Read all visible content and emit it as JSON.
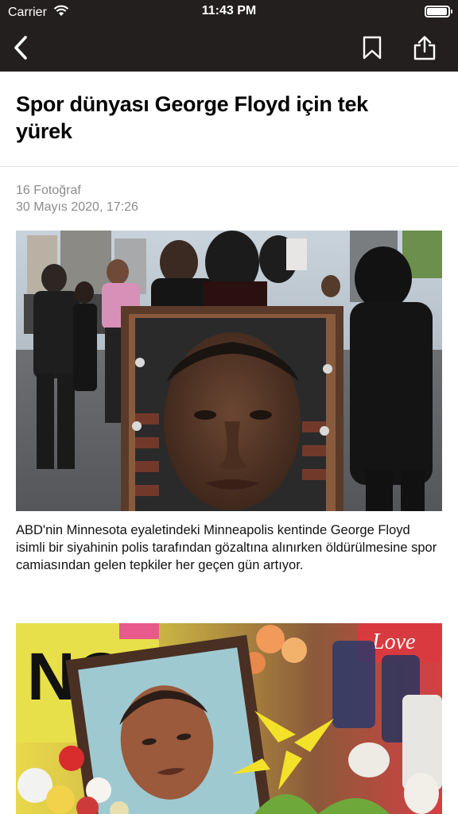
{
  "status_bar": {
    "carrier": "Carrier",
    "time": "11:43 PM",
    "battery_level": 0.95
  },
  "nav": {
    "back_icon": "chevron-left-icon",
    "bookmark_icon": "bookmark-icon",
    "share_icon": "share-icon"
  },
  "article": {
    "title": "Spor dünyası George Floyd için tek yürek",
    "photo_count": "16 Fotoğraf",
    "date": "30 Mayıs 2020, 17:26",
    "photos": [
      {
        "caption": "ABD'nin Minnesota eyaletindeki Minneapolis kentinde George Floyd isimli bir siyahinin polis tarafından gözaltına alınırken öldürülmesine spor camiasından gelen tepkiler her geçen gün artıyor."
      },
      {
        "sign_text": "NO",
        "sign_text_2": "Love"
      }
    ]
  },
  "colors": {
    "nav_background": "#231f1e",
    "meta_text": "#8c8c8c",
    "divider": "#e2e2e2"
  }
}
